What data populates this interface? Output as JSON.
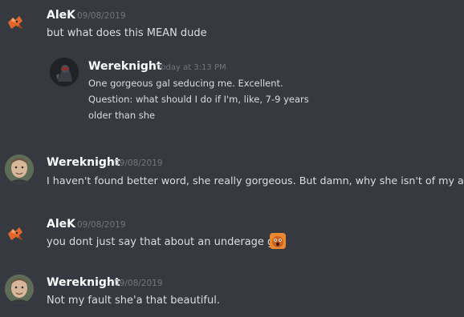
{
  "messages": [
    {
      "author": "AleK",
      "timestamp": "09/08/2019",
      "text": "but what does this MEAN dude",
      "avatar_icon": "fox-avatar-icon",
      "quote": {
        "author": "Wereknight",
        "timestamp": "Today at 3:13 PM",
        "lines": [
          "One gorgeous gal seducing me. Excellent.",
          "Question: what should I do if I'm, like, 7-9 years",
          "older than she"
        ],
        "avatar_icon": "dark-character-avatar-icon"
      }
    },
    {
      "author": "Wereknight",
      "timestamp": "09/08/2019",
      "text": "I haven't found better word, she really gorgeous. But damn, why she isn't of my age",
      "avatar_icon": "man-photo-avatar-icon"
    },
    {
      "author": "AleK",
      "timestamp": "09/08/2019",
      "text": "you dont just say that about an underage girl",
      "avatar_icon": "fox-avatar-icon",
      "emoji_icon": "shocked-face-emoji-icon"
    },
    {
      "author": "Wereknight",
      "timestamp": "09/08/2019",
      "text": "Not my fault she'a that beautiful.",
      "avatar_icon": "man-photo-avatar-icon"
    }
  ],
  "colors": {
    "background": "#36393f",
    "username": "#ffffff",
    "timestamp": "#72767d",
    "message_text": "#dcddde"
  }
}
